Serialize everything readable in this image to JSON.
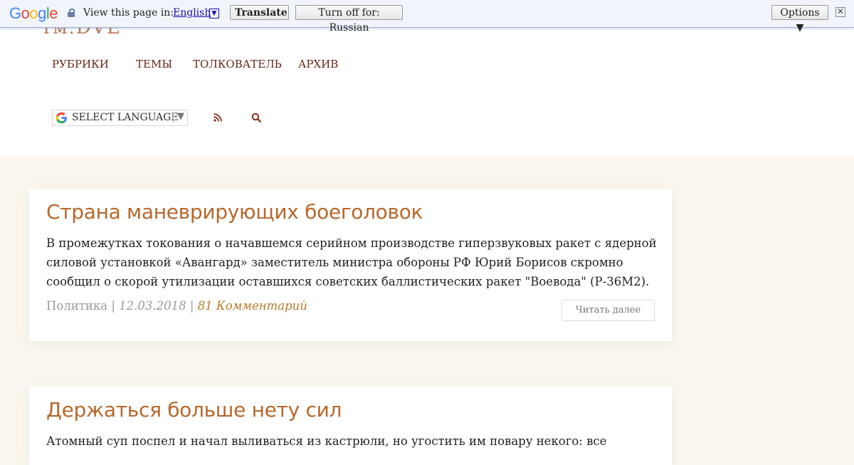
{
  "translate_bar": {
    "logo_letters": [
      "G",
      "o",
      "o",
      "g",
      "l",
      "e"
    ],
    "view_text": "View this page in:",
    "language": "English",
    "language_arrow": "▼",
    "translate_label": "Translate",
    "turn_off_label": "Turn off for: Russian",
    "options_label": "Options ▼",
    "close_label": "✕",
    "colors": {
      "blue": "#4285f4",
      "red": "#ea4335",
      "yellow": "#fbbc05",
      "green": "#34a853"
    }
  },
  "header": {
    "logo_fragment": "ᴛᴍ.DVE",
    "nav": [
      {
        "label": "РУБРИКИ"
      },
      {
        "label": "ТЕМЫ"
      },
      {
        "label": "ТОЛКОВАТЕЛЬ"
      },
      {
        "label": "АРХИВ"
      }
    ],
    "language_select": {
      "label": "SELECT LANGUAGE",
      "arrow": "▼"
    },
    "icons": {
      "rss": "rss-icon",
      "search": "search-icon"
    },
    "accent_color": "#6b2418"
  },
  "articles": [
    {
      "title": "Страна маневрирующих боеголовок",
      "excerpt": "В промежутках токования о начавшемся серийном производстве гиперзвуковых ракет с ядерной силовой установкой «Авангард» заместитель министра обороны РФ Юрий Борисов скромно сообщил о скорой утилизации оставшихся советских баллистических ракет \"Воевода\" (Р-36М2).",
      "category": "Политика",
      "separator": " | ",
      "date": "12.03.2018",
      "comments": "81 Комментарий",
      "read_more": "Читать далее"
    },
    {
      "title": "Держаться больше нету сил",
      "excerpt": "Атомный суп поспел и начал выливаться из кастрюли, но угостить им повару некого: все"
    }
  ],
  "colors": {
    "title": "#b8672a",
    "comments": "#b87a2a",
    "background": "#fbf7f0"
  }
}
